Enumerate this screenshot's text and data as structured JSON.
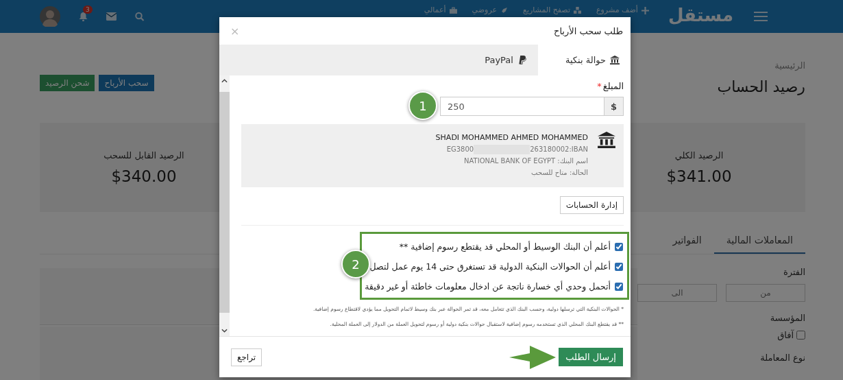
{
  "header": {
    "logo": "مستقل",
    "nav": [
      {
        "label": "أضف مشروع"
      },
      {
        "label": "تصفح المشاريع"
      },
      {
        "label": "عروضي"
      },
      {
        "label": "أعمالي"
      }
    ],
    "notifications_count": "3"
  },
  "page": {
    "breadcrumb": "الرئيسية",
    "title": "رصيد الحساب",
    "actions": [
      {
        "label": "سحب الأرباح",
        "kind": "primary"
      },
      {
        "label": "شحن الرصيد",
        "kind": "success"
      }
    ],
    "balances": [
      {
        "label": "الرصيد الكلي",
        "amount": "$341.00"
      },
      {
        "label": "الرصيد القابل للسحب",
        "amount": "$340.00"
      }
    ],
    "tabs": [
      {
        "label": "المعاملات المالية",
        "selected": true
      },
      {
        "label": "الفواتير",
        "selected": false
      }
    ],
    "filters": {
      "period_label": "الفترة",
      "from_placeholder": "من",
      "to_placeholder": "الى",
      "org_label": "المؤسسة",
      "orgs": [
        {
          "label": "آفاق",
          "checked": false
        }
      ],
      "type_label": "نوع المعاملة"
    }
  },
  "modal": {
    "title": "طلب سحب الأرباح",
    "close": "×",
    "tabs": [
      {
        "label": "حوالة بنكية",
        "selected": true
      },
      {
        "label": "PayPal",
        "selected": false
      }
    ],
    "amount_label": "المبلغ",
    "required_mark": "*",
    "currency": "$",
    "amount": "250",
    "account": {
      "holder": "SHADI MOHAMMED AHMED MOHAMMED",
      "iban_label": "IBAN:",
      "iban_start": "EG3800",
      "iban_end": "263180002",
      "bank": "اسم البنك: NATIONAL BANK OF EGYPT",
      "status": "الحالة: متاح للسحب"
    },
    "manage_button": "إدارة الحسابات",
    "agreements": [
      {
        "label": "أعلم أن البنك الوسيط أو المحلي قد يقتطع رسوم إضافية **",
        "checked": true
      },
      {
        "label": "أعلم أن الحوالات البنكية الدولية قد تستغرق حتى 14 يوم عمل لتصل",
        "checked": true
      },
      {
        "label": "أتحمل وحدي أي خسارة ناتجة عن ادخال معلومات خاطئة أو غير دقيقة",
        "checked": true
      }
    ],
    "footnotes": [
      "* الحوالات البنكية التي ترسلها دولية، وحسب البنك الذي تتعامل معه، قد تمر الحوالة عبر بنك وسيط لاتمام التحويل مما يؤدي لاقتطاع رسوم إضافية.",
      "** قد يقتطع البنك المحلي الذي تستخدمه رسوم إضافية لاستقبال حوالات بنكية دولية أو رسوم لتحويل العملة من الدولار إلى العملة المحلية."
    ],
    "submit": "إرسال الطلب",
    "back": "تراجع"
  },
  "annotations": [
    {
      "label": "1"
    },
    {
      "label": "2"
    }
  ]
}
